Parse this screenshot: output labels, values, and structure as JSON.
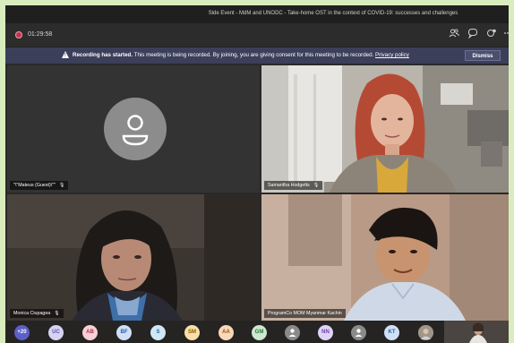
{
  "meeting": {
    "title": "Side Event - MdM and UNODC - Take-home OST in the context of COVID-19: successes and challenges",
    "timer": "01:29:58"
  },
  "banner": {
    "bold": "Recording has started.",
    "text": "This meeting is being recorded. By joining, you are giving consent for this meeting to be recorded.",
    "link": "Privacy policy",
    "dismiss": "Dismiss"
  },
  "tiles": [
    {
      "name": "\"\\\"Mateus (Guest)\\\"\""
    },
    {
      "name": "Samantha Hodgetts"
    },
    {
      "name": "Monica Ciupagea"
    },
    {
      "name": "ProgramCo MOM Myanmar Kachin"
    }
  ],
  "participants": [
    {
      "label": "+20",
      "bg": "#5b5fc7",
      "fg": "#ffffff"
    },
    {
      "label": "UC",
      "bg": "#d7d3f0",
      "fg": "#5b4fb0"
    },
    {
      "label": "AB",
      "bg": "#f6d0d6",
      "fg": "#b0304a"
    },
    {
      "label": "BF",
      "bg": "#cfe0f6",
      "fg": "#2c5aa0"
    },
    {
      "label": "S",
      "bg": "#cfe8f6",
      "fg": "#226b99"
    },
    {
      "label": "SM",
      "bg": "#f8e0a8",
      "fg": "#8a5a00"
    },
    {
      "label": "AA",
      "bg": "#f8d8b8",
      "fg": "#a05010"
    },
    {
      "label": "GM",
      "bg": "#cde8d0",
      "fg": "#2b7a3a"
    },
    {
      "label": "",
      "bg": "#8a8a8a",
      "fg": "#ffffff",
      "icon": "person-icon"
    },
    {
      "label": "NN",
      "bg": "#e0d4f4",
      "fg": "#6a3fb0"
    },
    {
      "label": "",
      "bg": "#8a8a8a",
      "fg": "#ffffff",
      "icon": "person-icon"
    },
    {
      "label": "KT",
      "bg": "#cfe0f6",
      "fg": "#2c5aa0"
    },
    {
      "label": "",
      "bg": "#a0958a",
      "fg": "#ffffff",
      "icon": "photo-avatar"
    }
  ],
  "icons": [
    "people-icon",
    "chat-icon",
    "reactions-icon",
    "more-icon",
    "warning-icon",
    "mic-off-icon",
    "person-icon"
  ]
}
